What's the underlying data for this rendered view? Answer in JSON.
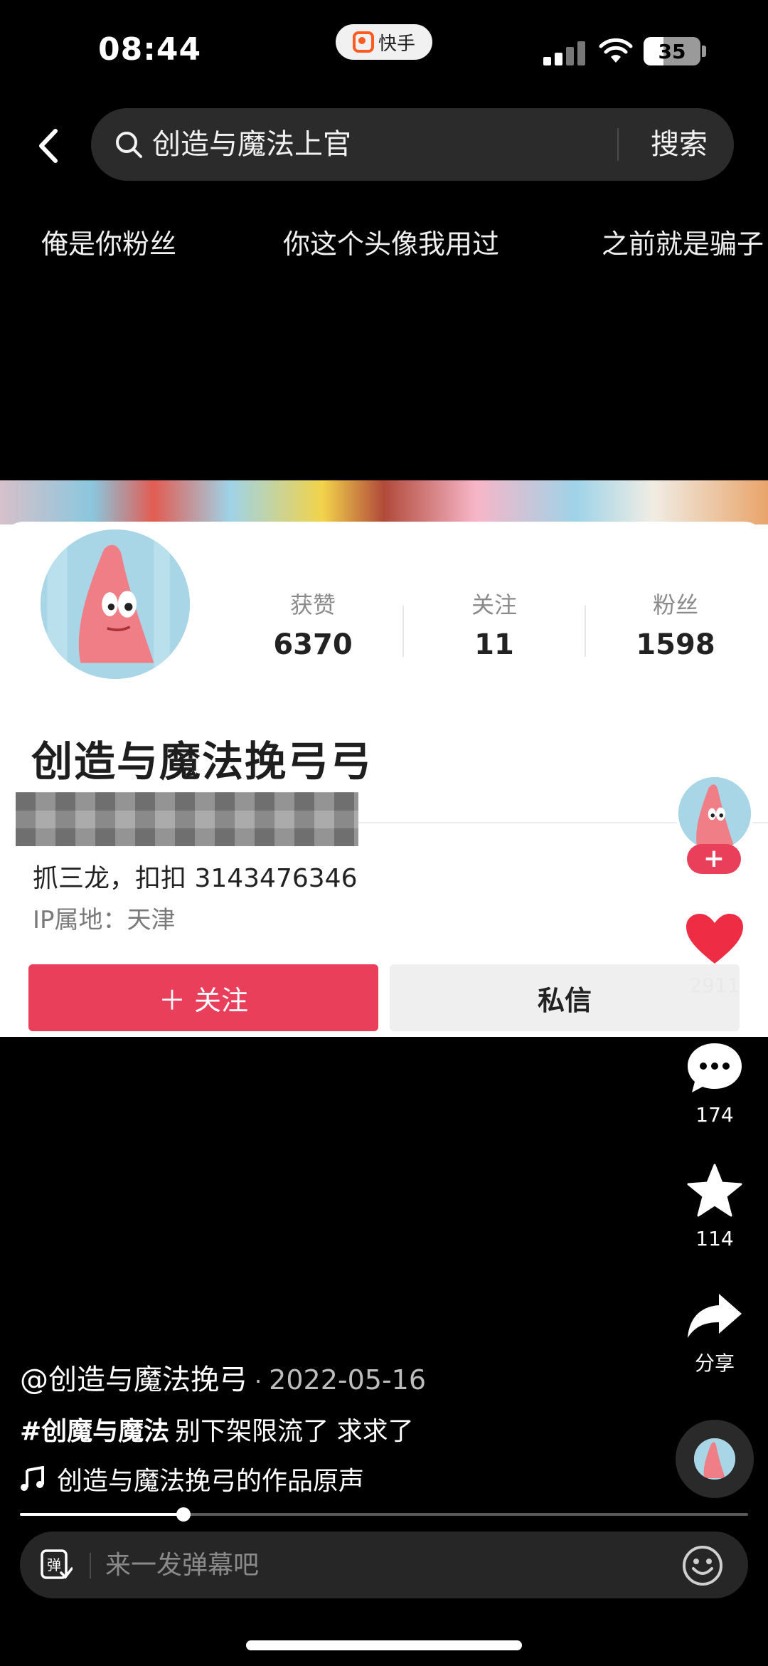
{
  "status_bar": {
    "time": "08:44",
    "app_badge": "快手",
    "battery_level": 35,
    "battery_text": "35"
  },
  "search": {
    "query": "创造与魔法上官",
    "button": "搜索"
  },
  "suggestions": [
    "俺是你粉丝",
    "你这个头像我用过",
    "之前就是骗子"
  ],
  "profile_card": {
    "stats": [
      {
        "label": "获赞",
        "value": "6370"
      },
      {
        "label": "关注",
        "value": "11"
      },
      {
        "label": "粉丝",
        "value": "1598"
      }
    ],
    "name": "创造与魔法挽弓弓",
    "bio": "抓三龙，扣扣 3143476346",
    "ip_location": "IP属地：天津",
    "follow_label": "＋ 关注",
    "message_label": "私信"
  },
  "actions": {
    "follow_plus": "+",
    "likes": "2911",
    "comments": "174",
    "favorites": "114",
    "share": "分享"
  },
  "post": {
    "author": "@创造与魔法挽弓",
    "dot": "·",
    "date": "2022-05-16",
    "hashtag": "#创魔与魔法",
    "caption": "别下架限流了 求求了",
    "music": "创造与魔法挽弓的作品原声"
  },
  "playback": {
    "progress": 0.225
  },
  "danmaku": {
    "placeholder": "来一发弹幕吧"
  },
  "colors": {
    "accent_red": "#ea3f5b",
    "background": "#000000"
  }
}
